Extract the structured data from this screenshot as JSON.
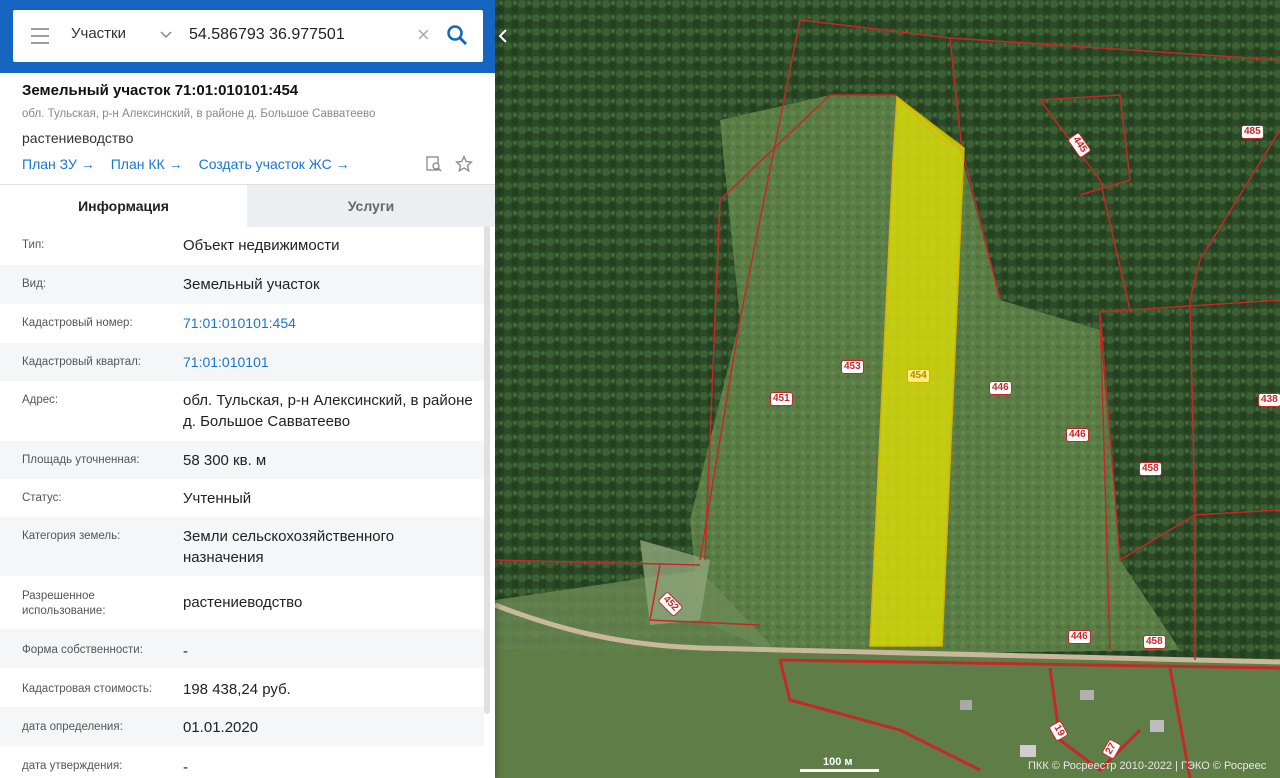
{
  "search": {
    "layer": "Участки",
    "query": "54.586793 36.977501"
  },
  "card": {
    "title": "Земельный участок 71:01:010101:454",
    "address": "обл. Тульская, р-н Алексинский, в районе д. Большое Савватеево",
    "use": "растениеводство",
    "links": [
      "План ЗУ →",
      "План КК →",
      "Создать участок ЖС →"
    ]
  },
  "tabs": [
    {
      "label": "Информация",
      "active": true
    },
    {
      "label": "Услуги",
      "active": false
    }
  ],
  "info": [
    {
      "label": "Тип:",
      "value": "Объект недвижимости"
    },
    {
      "label": "Вид:",
      "value": "Земельный участок"
    },
    {
      "label": "Кадастровый номер:",
      "value": "71:01:010101:454",
      "link": true
    },
    {
      "label": "Кадастровый квартал:",
      "value": "71:01:010101",
      "link": true
    },
    {
      "label": "Адрес:",
      "value": "обл. Тульская, р-н Алексинский, в районе д. Большое Савватеево"
    },
    {
      "label": "Площадь уточненная:",
      "value": "58 300 кв. м"
    },
    {
      "label": "Статус:",
      "value": "Учтенный"
    },
    {
      "label": "Категория земель:",
      "value": "Земли сельскохозяйственного назначения"
    },
    {
      "label": "Разрешенное использование:",
      "value": "растениеводство"
    },
    {
      "label": "Форма собственности:",
      "value": "-"
    },
    {
      "label": "Кадастровая стоимость:",
      "value": "198 438,24 руб."
    },
    {
      "label": "дата определения:",
      "value": "01.01.2020"
    },
    {
      "label": "дата утверждения:",
      "value": "-"
    }
  ],
  "map": {
    "parcel_labels": [
      "453",
      "454",
      "451",
      "446",
      "446",
      "438",
      "458",
      "452",
      "446",
      "458",
      "445",
      "485",
      "19",
      "27"
    ],
    "scale_label": "100 м",
    "copyright": "ПКК © Росреестр 2010-2022 | ГЭКО © Росреес",
    "colors": {
      "boundary": "#c62828",
      "selected_fill": "#e6e600",
      "panel_header": "#1565c0",
      "link": "#1976d2"
    }
  }
}
